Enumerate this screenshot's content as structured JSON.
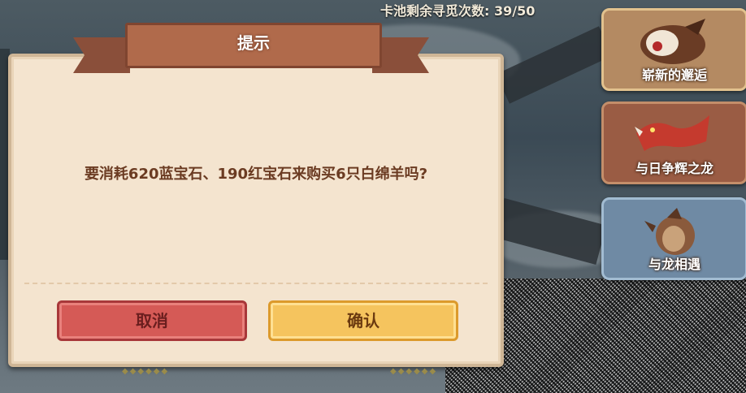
{
  "header": {
    "pool_counter": "卡池剩余寻觅次数: 39/50"
  },
  "side_cards": [
    {
      "label": "崭新的邂逅",
      "icon": "brown-dragon-roar-icon"
    },
    {
      "label": "与日争辉之龙",
      "icon": "red-dragon-icon"
    },
    {
      "label": "与龙相遇",
      "icon": "brown-dragon-sit-icon"
    }
  ],
  "dialog": {
    "title": "提示",
    "message": "要消耗620蓝宝石、190红宝石来购买6只白绵羊吗?",
    "cancel_label": "取消",
    "confirm_label": "确认"
  },
  "colors": {
    "cancel": "#d55a56",
    "confirm": "#f5c45e",
    "dialog_bg": "#f4e4cf",
    "banner": "#b06a4b"
  }
}
